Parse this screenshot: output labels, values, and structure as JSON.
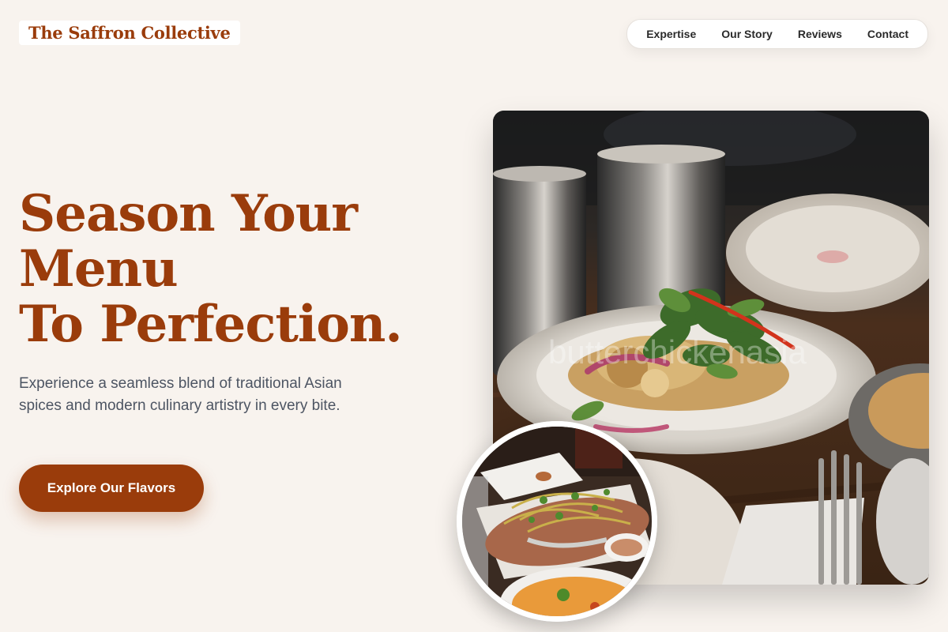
{
  "brand": {
    "name": "The Saffron Collective"
  },
  "nav": {
    "items": [
      {
        "label": "Expertise"
      },
      {
        "label": "Our Story"
      },
      {
        "label": "Reviews"
      },
      {
        "label": "Contact"
      }
    ]
  },
  "hero": {
    "title_lines": [
      "Season Your",
      "Menu",
      "To Perfection."
    ],
    "description": "Experience a seamless blend of traditional Asian spices and modern culinary artistry in every bite.",
    "cta_label": "Explore Our Flavors"
  },
  "images": {
    "main_watermark": "butterchickenasia"
  },
  "colors": {
    "background": "#f8f3ee",
    "accent": "#9a3c0b",
    "text_body": "#4d5563",
    "nav_text": "#2a2a2a"
  }
}
